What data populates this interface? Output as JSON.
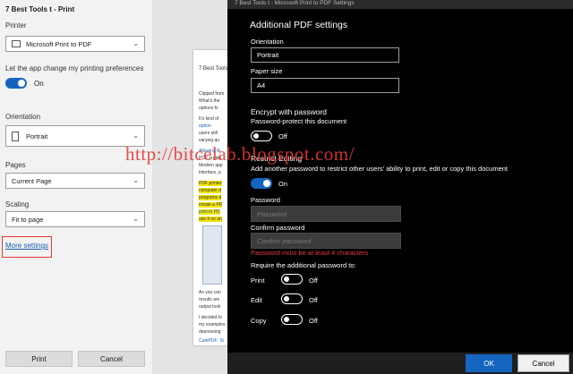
{
  "print_panel": {
    "title": "7 Best Tools t - Print",
    "printer_label": "Printer",
    "printer_value": "Microsoft Print to PDF",
    "allow_app_text": "Let the app change my printing preferences",
    "allow_app_toggle": "On",
    "orientation_label": "Orientation",
    "orientation_value": "Portrait",
    "pages_label": "Pages",
    "pages_value": "Current Page",
    "scaling_label": "Scaling",
    "scaling_value": "Fit to page",
    "more_settings": "More settings",
    "print_button": "Print",
    "cancel_button": "Cancel"
  },
  "preview": {
    "doc_title": "7 Best Tools",
    "lines": [
      "Clipped from",
      "What's the",
      "options fo",
      "It's kind of",
      "option",
      "users still",
      "varying qu",
      "Allowing lik",
      "PDF printer",
      "Modern app",
      "interface, p",
      "PDF printer",
      "computer d",
      "programs d",
      "create a PD",
      "print to PD",
      "use it on an",
      "As you can",
      "results are",
      "output look",
      "I decided to",
      "my examples",
      "depressing",
      "CutePDF: Si"
    ]
  },
  "window_title": "7 Best Tools t - Microsoft Print to PDF Settings",
  "dialog": {
    "title": "Additional PDF settings",
    "orientation_label": "Orientation",
    "orientation_value": "Portrait",
    "paper_size_label": "Paper size",
    "paper_size_value": "A4",
    "encrypt_title": "Encrypt with password",
    "encrypt_desc": "Password-protect this document",
    "encrypt_toggle": "Off",
    "restrict_title": "Restrict Editing",
    "restrict_desc": "Add another password to restrict other users' ability to print, edit or copy this document",
    "restrict_toggle": "On",
    "password_label": "Password",
    "password_placeholder": "Password",
    "confirm_label": "Confirm password",
    "confirm_placeholder": "Confirm password",
    "error_text": "Password must be at least 4 characters",
    "require_label": "Require the additional password to:",
    "options": [
      {
        "label": "Print",
        "state": "Off"
      },
      {
        "label": "Edit",
        "state": "Off"
      },
      {
        "label": "Copy",
        "state": "Off"
      }
    ],
    "ok_button": "OK",
    "cancel_button": "Cancel"
  },
  "watermark": "http://bitcelab.blogspot.com/",
  "colors": {
    "accent": "#1565c0",
    "error": "#e53935",
    "dialog_bg": "#000000"
  }
}
